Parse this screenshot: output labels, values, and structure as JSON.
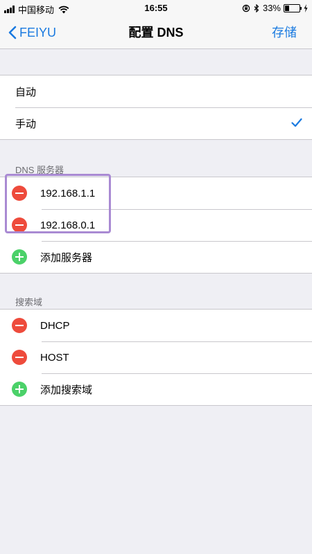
{
  "status_bar": {
    "carrier": "中国移动",
    "time": "16:55",
    "battery_percent": "33%",
    "battery_level": 0.33,
    "icons": [
      "signal-icon",
      "wifi-icon",
      "orientation-lock-icon",
      "bluetooth-icon",
      "battery-icon",
      "charging-icon"
    ]
  },
  "nav": {
    "back_label": "FEIYU",
    "title": "配置 DNS",
    "save_label": "存储"
  },
  "mode": {
    "options": [
      {
        "label": "自动",
        "selected": false
      },
      {
        "label": "手动",
        "selected": true
      }
    ]
  },
  "dns_servers": {
    "header": "DNS 服务器",
    "items": [
      "192.168.1.1",
      "192.168.0.1"
    ],
    "add_label": "添加服务器"
  },
  "search_domains": {
    "header": "搜索域",
    "items": [
      "DHCP",
      "HOST"
    ],
    "add_label": "添加搜索域"
  },
  "colors": {
    "accent": "#1a7ae0",
    "delete": "#ee4b3c",
    "add": "#4bd169",
    "highlight": "#a98ad3"
  }
}
